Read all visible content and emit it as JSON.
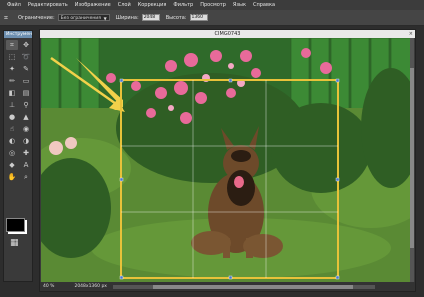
{
  "menu": {
    "items": [
      "Файл",
      "Редактировать",
      "Изображение",
      "Слой",
      "Коррекция",
      "Фильтр",
      "Просмотр",
      "Язык",
      "Справка"
    ]
  },
  "options": {
    "constraint_label": "Ограничение:",
    "constraint_value": "Без ограничения",
    "width_label": "Ширина:",
    "width_value": "2048",
    "height_label": "Высота:",
    "height_value": "1360"
  },
  "tools_panel": {
    "title": "Инструмен"
  },
  "image_window": {
    "title": "CIMG0743",
    "close": "×"
  },
  "status": {
    "zoom": "40",
    "zoom_unit": "%",
    "dimensions": "2048x1360 px"
  },
  "icons": [
    "crop-icon",
    "move-icon",
    "marquee-icon",
    "lasso-icon",
    "wand-icon",
    "brush-icon",
    "eraser-icon",
    "bucket-icon",
    "text-icon",
    "hand-icon",
    "zoom-icon",
    "eyedropper-icon",
    "pencil-icon",
    "stamp-icon",
    "blur-icon",
    "sponge-icon",
    "dodge-icon",
    "burn-icon",
    "smudge-icon",
    "sharpen-icon",
    "red-eye-icon",
    "gradient-icon",
    "heal-icon",
    "shape-icon",
    "grid-icon"
  ],
  "colors": {
    "foreground": "#000000",
    "background": "#ffffff",
    "crop_frame": "#e8c23a",
    "arrow": "#f2d14a"
  }
}
